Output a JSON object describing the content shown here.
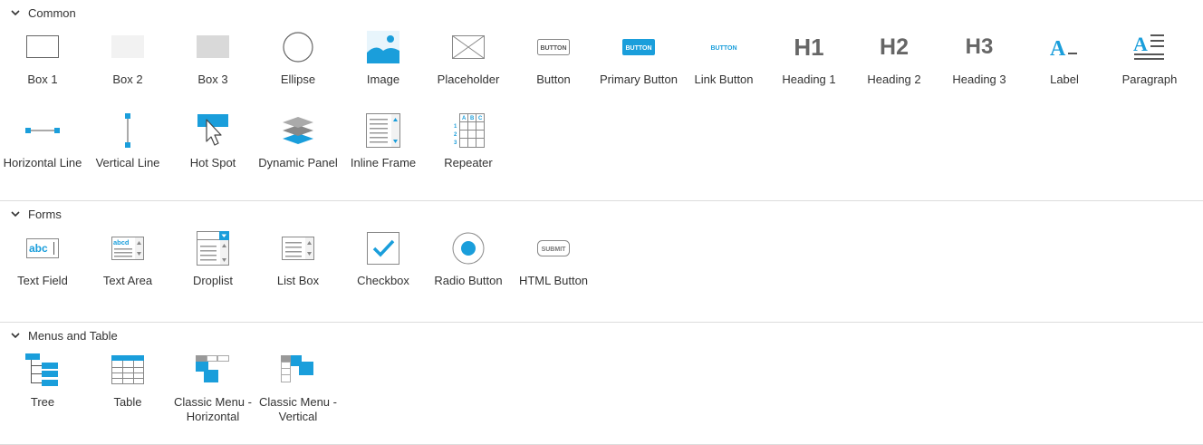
{
  "sections": [
    {
      "title": "Common",
      "items": [
        {
          "label": "Box 1",
          "icon": "box1-icon"
        },
        {
          "label": "Box 2",
          "icon": "box2-icon"
        },
        {
          "label": "Box 3",
          "icon": "box3-icon"
        },
        {
          "label": "Ellipse",
          "icon": "ellipse-icon"
        },
        {
          "label": "Image",
          "icon": "image-icon"
        },
        {
          "label": "Placeholder",
          "icon": "placeholder-icon"
        },
        {
          "label": "Button",
          "icon": "button-icon",
          "icon_text": "BUTTON"
        },
        {
          "label": "Primary Button",
          "icon": "primary-button-icon",
          "icon_text": "BUTTON"
        },
        {
          "label": "Link Button",
          "icon": "link-button-icon",
          "icon_text": "BUTTON"
        },
        {
          "label": "Heading 1",
          "icon": "heading1-icon",
          "icon_text": "H1"
        },
        {
          "label": "Heading 2",
          "icon": "heading2-icon",
          "icon_text": "H2"
        },
        {
          "label": "Heading 3",
          "icon": "heading3-icon",
          "icon_text": "H3"
        },
        {
          "label": "Label",
          "icon": "label-icon",
          "icon_text": "A"
        },
        {
          "label": "Paragraph",
          "icon": "paragraph-icon",
          "icon_text": "A"
        },
        {
          "label": "Horizontal Line",
          "icon": "horizontal-line-icon"
        },
        {
          "label": "Vertical Line",
          "icon": "vertical-line-icon"
        },
        {
          "label": "Hot Spot",
          "icon": "hot-spot-icon"
        },
        {
          "label": "Dynamic Panel",
          "icon": "dynamic-panel-icon"
        },
        {
          "label": "Inline Frame",
          "icon": "inline-frame-icon"
        },
        {
          "label": "Repeater",
          "icon": "repeater-icon",
          "icon_text": [
            "A",
            "B",
            "C",
            "1",
            "2",
            "3"
          ]
        }
      ]
    },
    {
      "title": "Forms",
      "items": [
        {
          "label": "Text Field",
          "icon": "text-field-icon",
          "icon_text": "abc"
        },
        {
          "label": "Text Area",
          "icon": "text-area-icon",
          "icon_text": "abcd"
        },
        {
          "label": "Droplist",
          "icon": "droplist-icon"
        },
        {
          "label": "List Box",
          "icon": "list-box-icon"
        },
        {
          "label": "Checkbox",
          "icon": "checkbox-icon"
        },
        {
          "label": "Radio Button",
          "icon": "radio-button-icon"
        },
        {
          "label": "HTML Button",
          "icon": "html-button-icon",
          "icon_text": "SUBMIT"
        }
      ]
    },
    {
      "title": "Menus and Table",
      "items": [
        {
          "label": "Tree",
          "icon": "tree-icon"
        },
        {
          "label": "Table",
          "icon": "table-icon"
        },
        {
          "label": "Classic Menu - Horizontal",
          "icon": "classic-menu-horizontal-icon"
        },
        {
          "label": "Classic Menu - Vertical",
          "icon": "classic-menu-vertical-icon"
        }
      ]
    }
  ],
  "colors": {
    "accent": "#1a9edb",
    "icon_gray": "#666666",
    "box2_fill": "#f2f2f2",
    "box3_fill": "#d9d9d9",
    "text": "#333333"
  }
}
